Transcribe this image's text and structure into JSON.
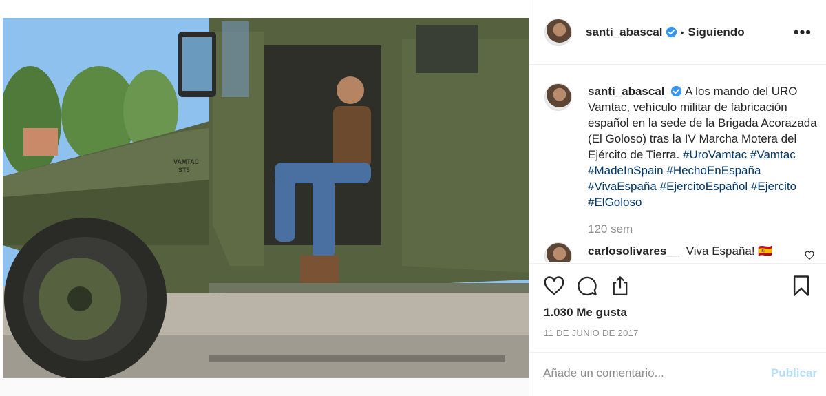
{
  "post": {
    "author": "santi_abascal",
    "follow_status": "Siguiendo",
    "more_label": "•••",
    "caption_text": "A los mando del URO Vamtac, vehículo militar de fabricación español en la sede de la Brigada Acorazada (El Goloso) tras la IV Marcha Motera del Ejército de Tierra.",
    "hashtags": [
      "#UroVamtac",
      "#Vamtac",
      "#MadeInSpain",
      "#HechoEnEspaña",
      "#VivaEspaña",
      "#EjercitoEspañol",
      "#Ejercito",
      "#ElGoloso"
    ],
    "caption_time": "120 sem",
    "likes": "1.030 Me gusta",
    "date": "11 DE JUNIO DE 2017"
  },
  "photo": {
    "vehicle_badge": "VAMTAC",
    "vehicle_model": "ST5"
  },
  "comments": [
    {
      "user": "carlosolivares__",
      "text": "Viva España! 🇪🇸"
    }
  ],
  "composer": {
    "placeholder": "Añade un comentario...",
    "publish_label": "Publicar"
  },
  "colors": {
    "verified": "#3897f0",
    "hashtag": "#00376b",
    "publish_disabled": "#b2dffc",
    "vehicle": "#4e5a3a"
  },
  "icons": [
    "heart-icon",
    "comment-icon",
    "share-icon",
    "bookmark-icon",
    "more-options-icon",
    "verified-icon"
  ]
}
